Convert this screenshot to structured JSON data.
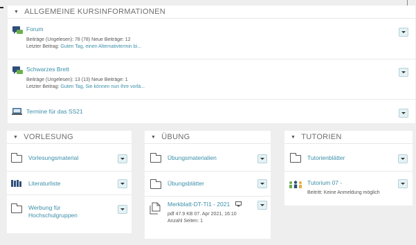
{
  "top_block": {
    "header": "ALLGEMEINE KURSINFORMATIONEN",
    "items": [
      {
        "icon": "forum-icon",
        "title": "Forum",
        "line1": "Beiträge (Ungelesen): 78 (78)   Neue Beiträge: 12",
        "line2_prefix": "Letzter Beitrag: ",
        "line2_link": "Guten Tag, einen Alternativtermin bi..."
      },
      {
        "icon": "forum-icon",
        "title": "Schwarzes Brett",
        "line1": "Beiträge (Ungelesen): 13 (13)   Neue Beiträge: 1",
        "line2_prefix": "Letzter Beitrag: ",
        "line2_link": "Guten Tag, Sie können nun Ihre vorlä..."
      },
      {
        "icon": "calendar-icon",
        "title": "Termine für das SS21"
      }
    ]
  },
  "vorlesung": {
    "header": "VORLESUNG",
    "items": [
      {
        "icon": "folder-icon",
        "title": "Vorlesungsmaterial"
      },
      {
        "icon": "books-icon",
        "title": "Literaturliste"
      },
      {
        "icon": "folder-icon",
        "title_line1": "Werbung für",
        "title_line2": "Hochschulgruppen"
      }
    ]
  },
  "uebung": {
    "header": "ÜBUNG",
    "items": [
      {
        "icon": "folder-icon",
        "title": "Übungsmaterialien"
      },
      {
        "icon": "folder-icon",
        "title": "Übungsblätter"
      },
      {
        "icon": "file-icon",
        "title": "Merkblatt-DT-TI1 - 2021",
        "extra_icon": "monitor-icon",
        "meta1": "pdf   47.9 KB   07. Apr 2021, 16:10",
        "meta2": "Anzahl Seiten: 1"
      }
    ]
  },
  "tutorien": {
    "header": "TUTORIEN",
    "items": [
      {
        "icon": "folder-icon",
        "title": "Tutorienblätter"
      },
      {
        "icon": "group-icon",
        "title": "Tutorium 07 -",
        "meta": "Beitritt: Keine Anmeldung möglich"
      }
    ]
  },
  "colors": {
    "link": "#3a8fa8",
    "dropdown_bg": "#e4f2f5",
    "page_bg": "#eeeeee"
  }
}
